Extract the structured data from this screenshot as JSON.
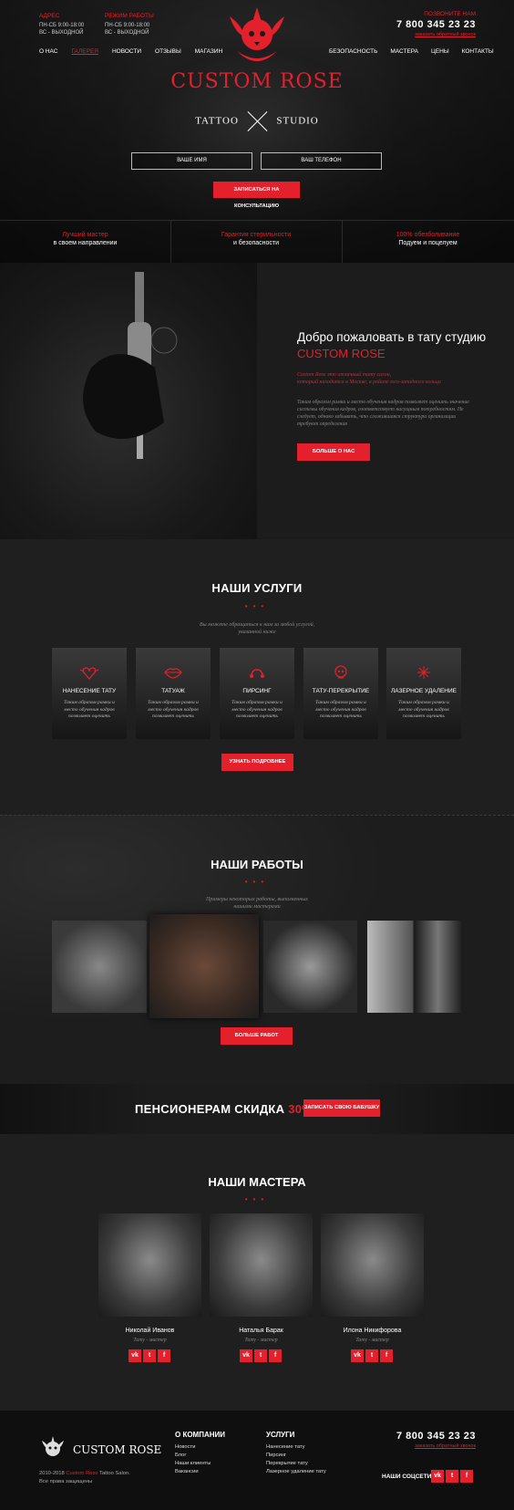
{
  "header": {
    "address_label": "АДРЕС",
    "address_lines": [
      "ПН-СБ 9:00-18:00",
      "ВС - ВЫХОДНОЙ"
    ],
    "hours_label": "РЕЖИМ РАБОТЫ",
    "hours_lines": [
      "ПН-СБ 9:00-18:00",
      "ВС - ВЫХОДНОЙ"
    ],
    "call_label": "ПОЗВОНИТЕ НАМ",
    "phone": "7 800 345 23 23",
    "callback": "заказать обратный звонок",
    "nav_left": [
      "О НАС",
      "ГАЛЕРЕЯ",
      "НОВОСТИ",
      "ОТЗЫВЫ",
      "МАГАЗИН"
    ],
    "nav_right": [
      "БЕЗОПАСНОСТЬ",
      "МАСТЕРА",
      "ЦЕНЫ",
      "КОНТАКТЫ"
    ],
    "brand": "CUSTOM ROSE",
    "tagline_left": "TATTOO",
    "tagline_right": "STUDIO",
    "name_placeholder": "ВАШЕ ИМЯ",
    "phone_placeholder": "ВАШ ТЕЛЕФОН",
    "cta": "ЗАПИСАТЬСЯ НА КОНСУЛЬТАЦИЮ"
  },
  "benefits": [
    {
      "accent": "Лучший мастер",
      "text": "в своем направлении"
    },
    {
      "accent": "Гарантия стерильности",
      "text": "и безопасности"
    },
    {
      "accent": "100% обезболивание",
      "text": "Подуем и поцелуем"
    }
  ],
  "welcome": {
    "title": "Добро пожаловать в тату студию",
    "brand": "CUSTOM ROSE",
    "intro_1": "Custom Rose это отличный тату салон,",
    "intro_2": "который находится в Москве, в районе юго-западного кольца",
    "body": "Таким образом рамки и место обучения кадров позволяет оценить значение системы обучения кадров, соответствует насущным потребностям. Не следует, однако забывать, что сложившаяся структура организации требуют определения",
    "button": "БОЛЬШЕ О НАС"
  },
  "services": {
    "title": "НАШИ УСЛУГИ",
    "lead_1": "Вы можете обращаться к нам за любой услугой,",
    "lead_2": "указанной ниже",
    "items": [
      {
        "title": "НАНЕСЕНИЕ ТАТУ",
        "text": "Таким образом рамки и место обучения кадров позволяет оценить"
      },
      {
        "title": "ТАТУАЖ",
        "text": "Таким образом рамки и место обучения кадров позволяет оценить"
      },
      {
        "title": "ПИРСИНГ",
        "text": "Таким образом рамки и место обучения кадров позволяет оценить"
      },
      {
        "title": "ТАТУ-ПЕРЕКРЫТИЕ",
        "text": "Таким образом рамки и место обучения кадров позволяет оценить"
      },
      {
        "title": "ЛАЗЕРНОЕ УДАЛЕНИЕ",
        "text": "Таким образом рамки и место обучения кадров позволяет оценить"
      }
    ],
    "button": "УЗНАТЬ ПОДРОБНЕЕ"
  },
  "works": {
    "title": "НАШИ РАБОТЫ",
    "lead_1": "Примеры некоторых работы, выполненных",
    "lead_2": "нашими мастерами",
    "button": "БОЛЬШЕ РАБОТ"
  },
  "discount": {
    "text": "ПЕНСИОНЕРАМ СКИДКА",
    "value": "30%",
    "button": "ЗАПИСАТЬ СВОЮ БАБУШКУ"
  },
  "masters": {
    "title": "НАШИ МАСТЕРА",
    "items": [
      {
        "name": "Николай Иванов",
        "role": "Тату - мастер"
      },
      {
        "name": "Наталья Барак",
        "role": "Тату - мастер"
      },
      {
        "name": "Илона Никифорова",
        "role": "Тату - мастер"
      }
    ],
    "social": [
      "vk",
      "t",
      "f"
    ]
  },
  "footer": {
    "brand": "CUSTOM ROSE",
    "copy_1_pre": "2010-2018",
    "copy_1_brand": "Custom Rose",
    "copy_1_post": "Tattoo Salon.",
    "copy_2": "Все права защищены",
    "company_title": "О КОМПАНИИ",
    "company_links": [
      "Новости",
      "Блог",
      "Наши клиенты",
      "Вакансии"
    ],
    "services_title": "УСЛУГИ",
    "services_links": [
      "Нанесение тату",
      "Пирсинг",
      "Перекрытие тату",
      "Лазерное удаление тату"
    ],
    "phone": "7 800 345 23 23",
    "callback": "заказать обратный звонок",
    "social_label": "НАШИ СОЦСЕТИ:"
  },
  "colors": {
    "accent": "#e3202c",
    "background": "#1f1f20"
  }
}
